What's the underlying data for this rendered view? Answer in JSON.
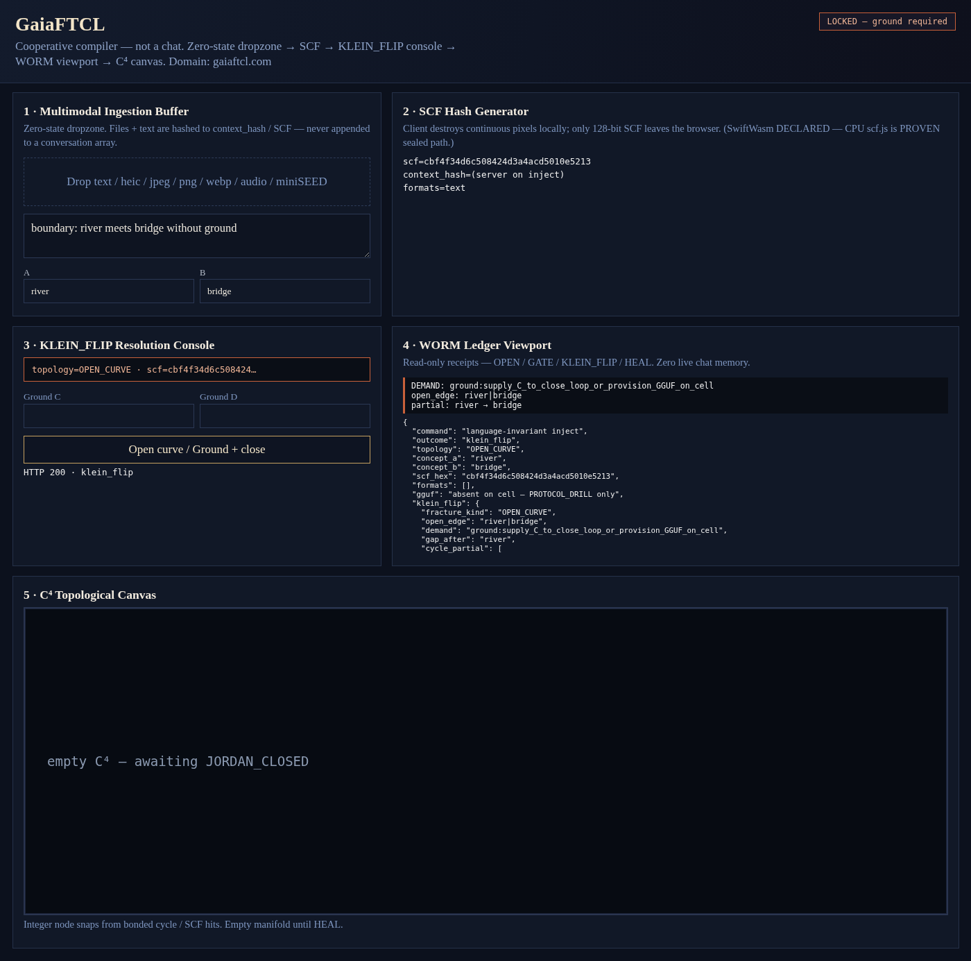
{
  "header": {
    "title": "GaiaFTCL",
    "subtitle": "Cooperative compiler — not a chat. Zero-state dropzone → SCF → KLEIN_FLIP console → WORM viewport → C⁴ canvas. Domain: gaiaftcl.com",
    "status_badge": "LOCKED — ground required"
  },
  "ingestion": {
    "title": "1 · Multimodal Ingestion Buffer",
    "description": "Zero-state dropzone. Files + text are hashed to context_hash / SCF — never appended to a conversation array.",
    "dropzone": "Drop text / heic / jpeg / png / webp / audio / miniSEED",
    "text_input": {
      "value": "boundary: river meets bridge without ground"
    },
    "fields": [
      {
        "label": "A",
        "value": "river"
      },
      {
        "label": "B",
        "value": "bridge"
      }
    ]
  },
  "scf": {
    "title": "2 · SCF Hash Generator",
    "description": "Client destroys continuous pixels locally; only 128-bit SCF leaves the browser. (SwiftWasm DECLARED — CPU scf.js is PROVEN sealed path.)",
    "output_lines": [
      "scf=cbf4f34d6c508424d3a4acd5010e5213",
      "context_hash=(server on inject)",
      "formats=text"
    ]
  },
  "klein_flip": {
    "title": "3 · KLEIN_FLIP Resolution Console",
    "topology_line": "topology=OPEN_CURVE · scf=cbf4f34d6c508424…",
    "fields": [
      {
        "label": "Ground C"
      },
      {
        "label": "Ground D"
      }
    ],
    "button": "Open curve / Ground + close",
    "status": "HTTP 200 · klein_flip"
  },
  "worm": {
    "title": "4 · WORM Ledger Viewport",
    "description": "Read-only receipts — OPEN / GATE / KLEIN_FLIP / HEAL. Zero live chat memory.",
    "demand_lines": [
      "DEMAND: ground:supply_C_to_close_loop_or_provision_GGUF_on_cell",
      "open_edge: river|bridge",
      "partial: river → bridge"
    ],
    "receipt_lines": [
      "{",
      "  \"command\": \"language-invariant inject\",",
      "  \"outcome\": \"klein_flip\",",
      "  \"topology\": \"OPEN_CURVE\",",
      "  \"concept_a\": \"river\",",
      "  \"concept_b\": \"bridge\",",
      "  \"scf_hex\": \"cbf4f34d6c508424d3a4acd5010e5213\",",
      "  \"formats\": [],",
      "  \"gguf\": \"absent on cell — PROTOCOL_DRILL only\",",
      "  \"klein_flip\": {",
      "    \"fracture_kind\": \"OPEN_CURVE\",",
      "    \"open_edge\": \"river|bridge\",",
      "    \"demand\": \"ground:supply_C_to_close_loop_or_provision_GGUF_on_cell\",",
      "    \"gap_after\": \"river\",",
      "    \"cycle_partial\": ["
    ]
  },
  "canvas": {
    "title": "5 · C⁴ Topological Canvas",
    "message": "empty C⁴ — awaiting JORDAN_CLOSED",
    "caption": "Integer node snaps from bonded cycle / SCF hits. Empty manifold until HEAL."
  }
}
